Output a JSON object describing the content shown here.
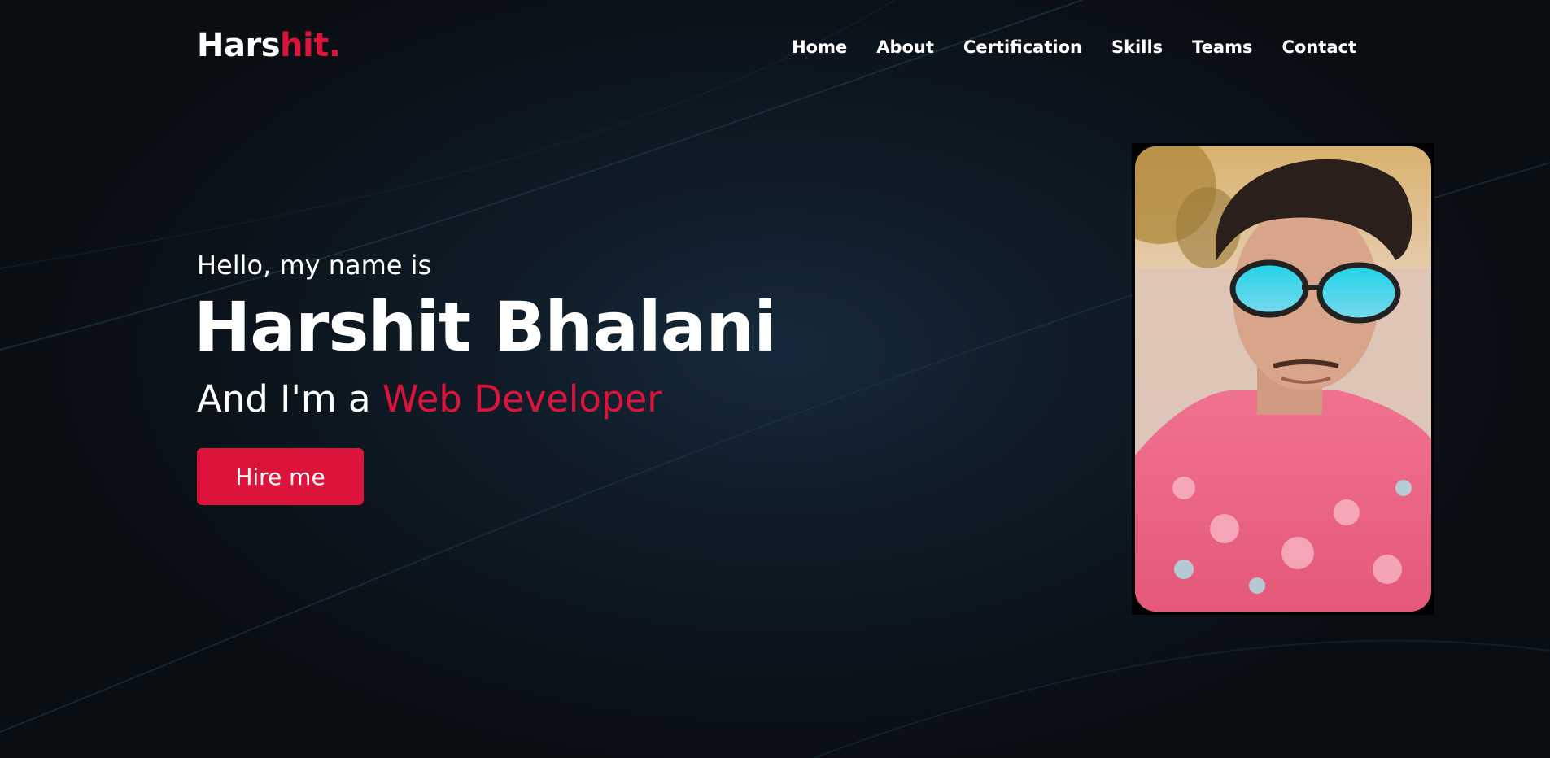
{
  "logo": {
    "main": "Hars",
    "accent": "hit."
  },
  "nav": {
    "items": [
      {
        "label": "Home",
        "name": "nav-home"
      },
      {
        "label": "About",
        "name": "nav-about"
      },
      {
        "label": "Certification",
        "name": "nav-certification"
      },
      {
        "label": "Skills",
        "name": "nav-skills"
      },
      {
        "label": "Teams",
        "name": "nav-teams"
      },
      {
        "label": "Contact",
        "name": "nav-contact"
      }
    ]
  },
  "hero": {
    "greeting": "Hello, my name is",
    "name": "Harshit Bhalani",
    "role_prefix": "And I'm a",
    "role_accent": "Web Developer",
    "cta_label": "Hire me",
    "portrait_alt": "profile-photo"
  },
  "colors": {
    "accent": "#dc143c",
    "background": "#0b1117",
    "text": "#ffffff"
  }
}
